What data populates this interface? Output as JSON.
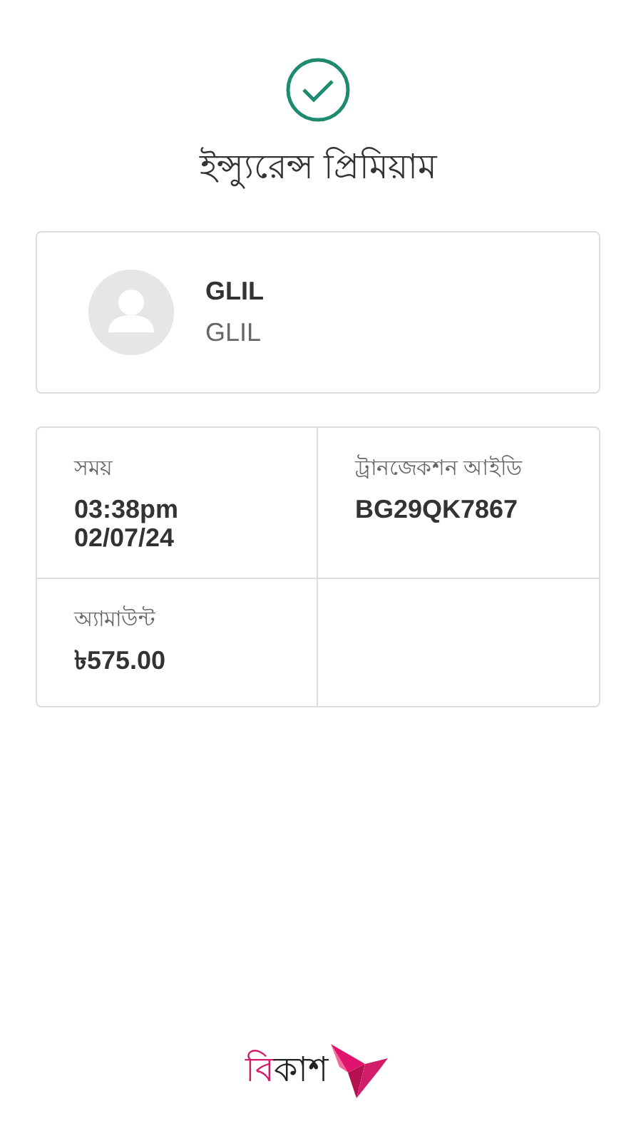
{
  "title": "ইন্স্যুরেন্স প্রিমিয়াম",
  "recipient": {
    "name": "GLIL",
    "subtitle": "GLIL"
  },
  "details": [
    {
      "label": "সময়",
      "value": "03:38pm\n02/07/24"
    },
    {
      "label": "ট্রানজেকশন আইডি",
      "value": "BG29QK7867"
    },
    {
      "label": "অ্যামাউন্ট",
      "value": "৳575.00"
    }
  ],
  "logo": {
    "accent": "বি",
    "rest": "কাশ"
  }
}
